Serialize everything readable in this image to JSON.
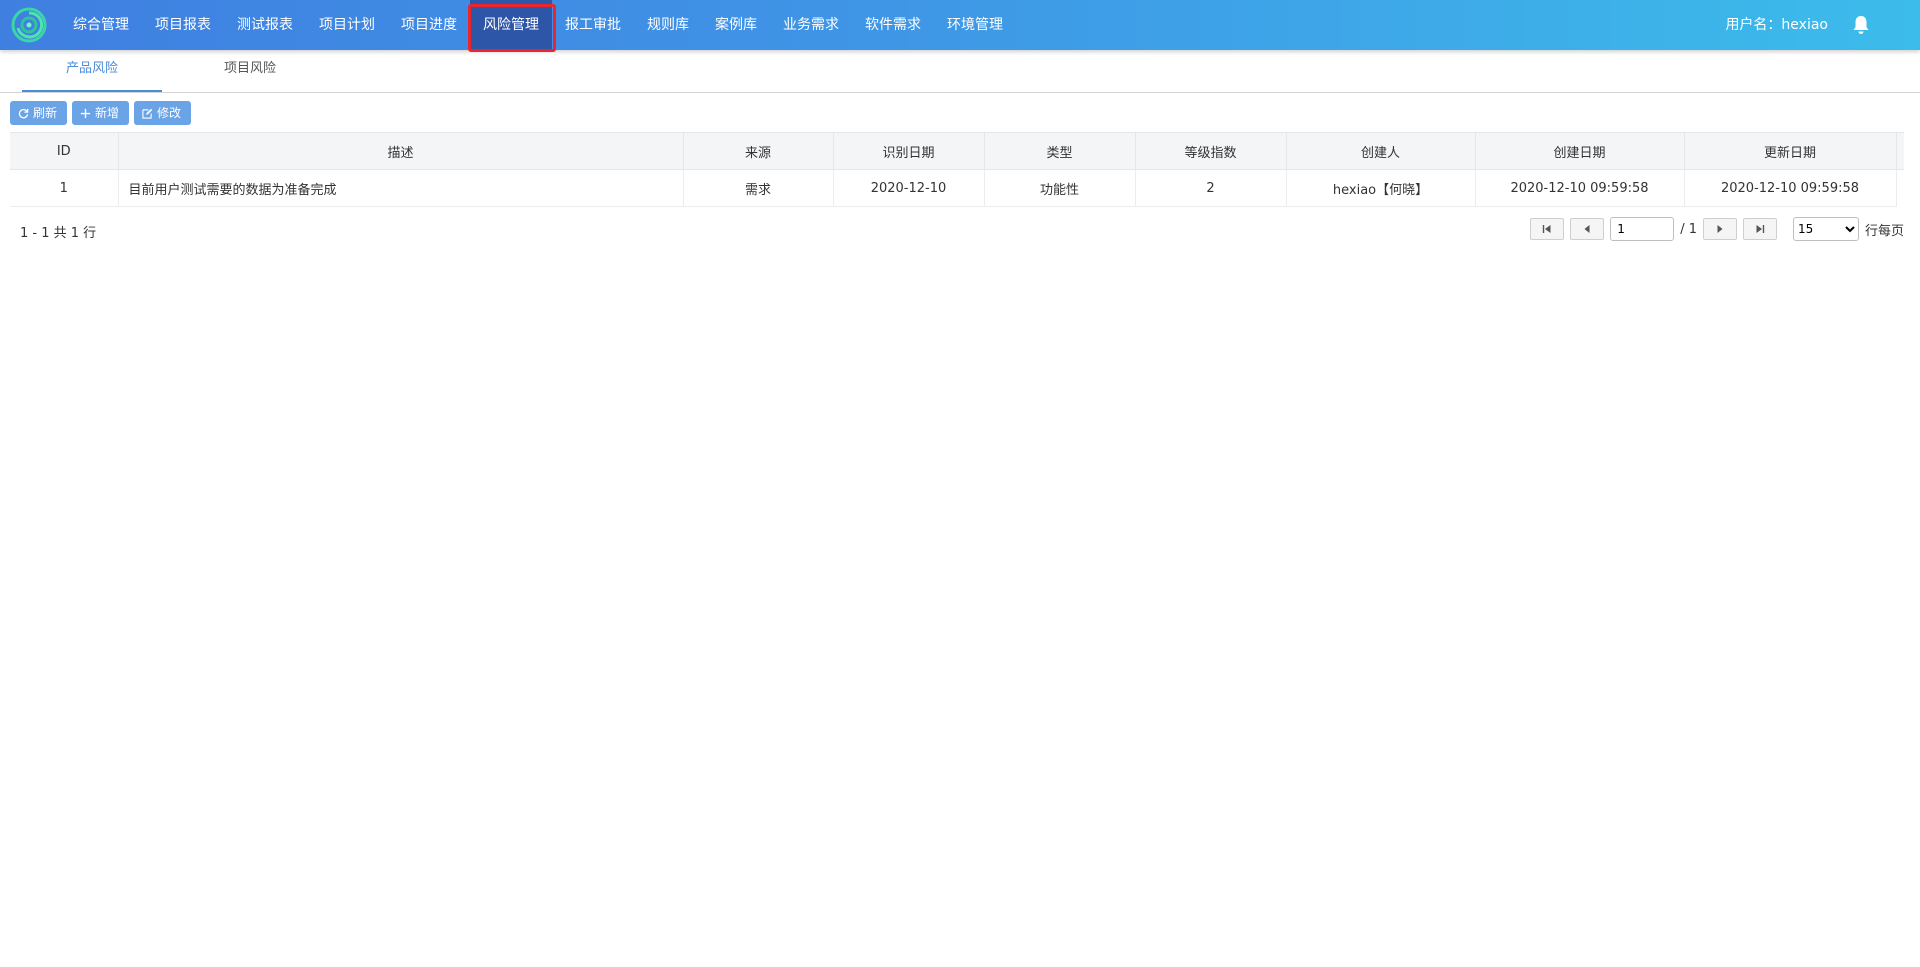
{
  "nav": {
    "items": [
      {
        "label": "综合管理"
      },
      {
        "label": "项目报表"
      },
      {
        "label": "测试报表"
      },
      {
        "label": "项目计划"
      },
      {
        "label": "项目进度"
      },
      {
        "label": "风险管理"
      },
      {
        "label": "报工审批"
      },
      {
        "label": "规则库"
      },
      {
        "label": "案例库"
      },
      {
        "label": "业务需求"
      },
      {
        "label": "软件需求"
      },
      {
        "label": "环境管理"
      }
    ],
    "active_index": 5,
    "user_label": "用户名：hexiao",
    "accent": "#e8262b"
  },
  "tabs": [
    {
      "label": "产品风险",
      "active": true
    },
    {
      "label": "项目风险",
      "active": false
    }
  ],
  "toolbar": {
    "refresh_label": "刷新",
    "add_label": "新增",
    "edit_label": "修改"
  },
  "table": {
    "columns": [
      "ID",
      "描述",
      "来源",
      "识别日期",
      "类型",
      "等级指数",
      "创建人",
      "创建日期",
      "更新日期"
    ],
    "rows": [
      {
        "id": "1",
        "desc": "目前用户测试需要的数据为准备完成",
        "source": "需求",
        "identified": "2020-12-10",
        "type": "功能性",
        "level": "2",
        "creator": "hexiao【何晓】",
        "created": "2020-12-10 09:59:58",
        "updated": "2020-12-10 09:59:58"
      }
    ]
  },
  "pager": {
    "info": "1 - 1 共 1 行",
    "page_value": "1",
    "total_pages": "/ 1",
    "page_size": "15",
    "page_size_suffix": "行每页"
  }
}
